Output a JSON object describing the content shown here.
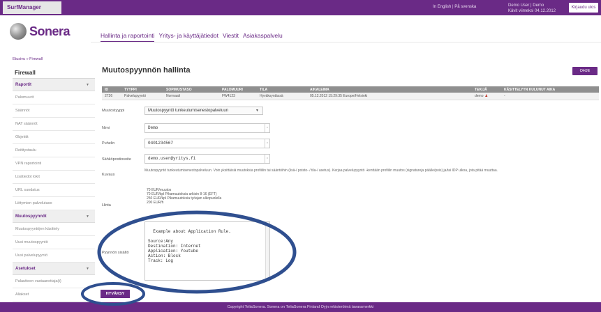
{
  "app": {
    "brand": "SurfManager",
    "lang_links": "In English | På svenska",
    "user_line1": "Demo User | Demo",
    "user_line2": "Kävit viimeksi 04.12.2012",
    "logout_label": "Kirjaudu ulos"
  },
  "logo": {
    "name": "Sonera"
  },
  "nav": {
    "items": [
      "Hallinta ja raportointi",
      "Yritys- ja käyttäjätiedot",
      "Viestit",
      "Asiakaspalvelu"
    ]
  },
  "breadcrumb": "Etusivu » Firewall",
  "sidebar": {
    "title": "Firewall",
    "section_reports": "Raportit",
    "report_items": [
      "Palomuurit",
      "Säännöt",
      "NAT säännöt",
      "Objektit",
      "Reititystaulu",
      "VPN raportointi",
      "Lisätiedot lokit",
      "URL suodatus",
      "Liittymien palvelutaso"
    ],
    "section_requests": "Muutospyynnöt",
    "request_items": [
      "Muutospyyntöjen käsittely",
      "Uusi muutospyyntö",
      "Uusi palvelupyyntö"
    ],
    "section_tools": "Asetukset",
    "tool_items": [
      "Palautteen vastaanottaja(t)",
      "Aliakset"
    ]
  },
  "main": {
    "title": "Muutospyynnön hallinta",
    "help_label": "OHJE",
    "table": {
      "headers": [
        "ID",
        "TYYPPI",
        "SOPIMUSTASO",
        "PALOMUURI",
        "TILA",
        "AIKALEIMA",
        "TEKIJÄ",
        "KÄSITTELYYN KULUNUT AIKA"
      ],
      "rows": [
        [
          "2726",
          "Palvelupyyntö",
          "Normaali",
          "FW4123",
          "Hyväksyntässä",
          "05.12.2012 15:29:35 Europe/Helsinki",
          "demo",
          "-"
        ]
      ]
    },
    "form": {
      "type_label": "Muutostyyppi",
      "type_value": "Muutospyyntö tunkeutumisenestopalveluun",
      "name_label": "Nimi",
      "name_value": "Demo",
      "phone_label": "Puhelin",
      "phone_value": "0401234567",
      "email_label": "Sähköpostiosoite",
      "email_value": "demo.user@yritys.fi",
      "desc_label": "Kuvaus",
      "desc_text": "Muutospyyntö tunkeutumisenestopalveluun. Voin yksittäisiä muutoksia profiiliin tai sääntöihin (lisä-/ poisto- / tila-/ asetus). Kerjaa palvelupyyntö -kenttään profiilin muutos (signatureja päälle/pois) ja/tai IDP ulkoa, jota pitää muuttaa.",
      "price_label": "Hinta",
      "prices": [
        "70 EUR/muutos",
        "70 EUR/kpl Pikamuutoksia arkisin 8-16 (EFT)",
        "250 EUR/kpl Pikamuutoksia työajan ulkopuolella",
        "200 EUR/h"
      ],
      "content_label": "Pyynnön sisältö",
      "content_value": "Example about Application Rule.\n\nSource:Any\nDestination: Internet\nApplication: Youtube\nAction: Block\nTrack: Log"
    },
    "approve_label": "HYVÄKSY"
  },
  "footer": "Copyright TeliaSonera. Sonera on TeliaSonera Finland Oyjn rekisteröimä tavaramerkki",
  "colors": {
    "brand": "#6a2a86",
    "annotation": "#2f4f8f"
  }
}
